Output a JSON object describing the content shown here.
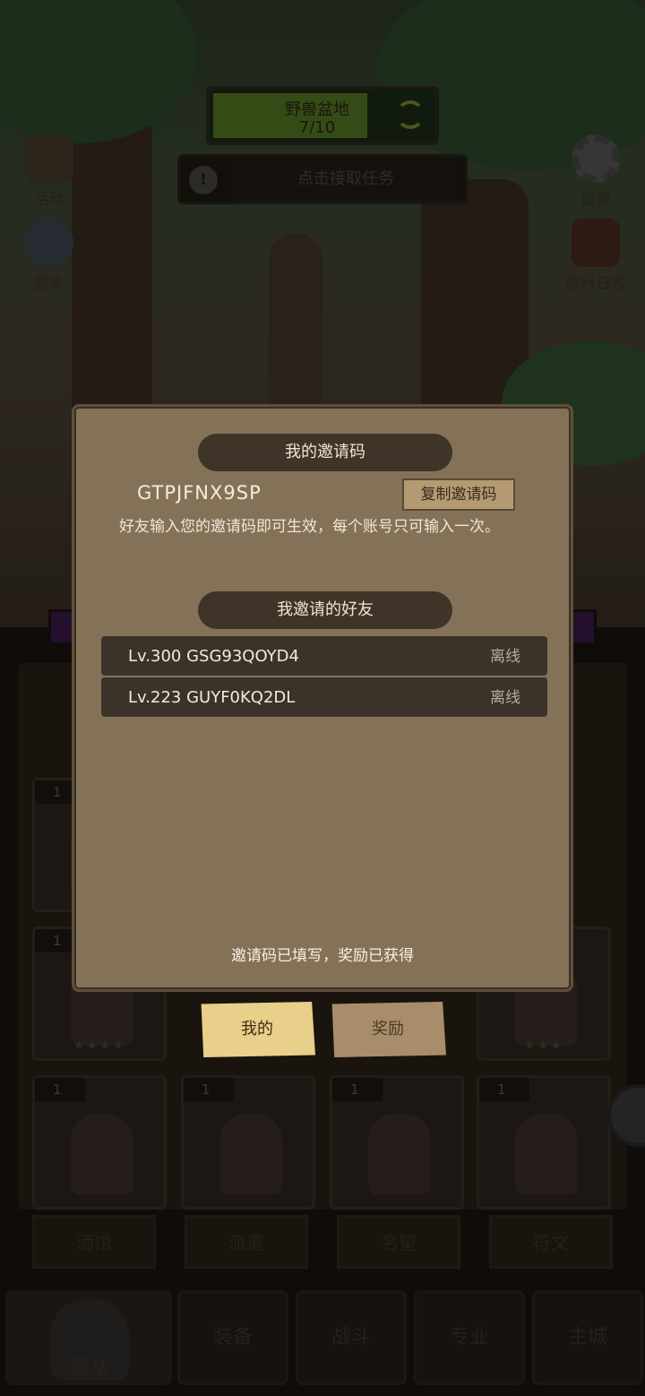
{
  "background": {
    "map_title": "野兽盆地",
    "map_progress": "7/10",
    "task_prompt": "点击接取任务",
    "left_icons": [
      {
        "label": "活动",
        "icon": "scroll-icon"
      },
      {
        "label": "副本",
        "icon": "portal-icon"
      }
    ],
    "right_icons": [
      {
        "label": "设置",
        "icon": "gear-icon"
      },
      {
        "label": "旅行日志",
        "icon": "journal-icon"
      }
    ],
    "hero_levels": [
      "1",
      "1",
      "1",
      "1",
      "1",
      "1",
      "1"
    ],
    "bottom_buttons": [
      "酒馆",
      "派遣",
      "名望",
      "符文"
    ],
    "nav_tabs": [
      "随从",
      "装备",
      "战斗",
      "专业",
      "主城"
    ]
  },
  "dialog": {
    "my_code_title": "我的邀请码",
    "invite_code": "GTPJFNX9SP",
    "copy_button": "复制邀请码",
    "description": "好友输入您的邀请码即可生效，每个账号只可输入一次。",
    "friends_title": "我邀请的好友",
    "friends": [
      {
        "name": "Lv.300 GSG93QOYD4",
        "status": "离线"
      },
      {
        "name": "Lv.223 GUYF0KQ2DL",
        "status": "离线"
      }
    ],
    "filled_note": "邀请码已填写，奖励已获得"
  },
  "tabs": {
    "mine": "我的",
    "reward": "奖励"
  },
  "colors": {
    "dialog_bg": "#847258",
    "title_pill": "#3e3428",
    "active_tab": "#e8cf8a",
    "inactive_tab": "#a88d6a"
  }
}
